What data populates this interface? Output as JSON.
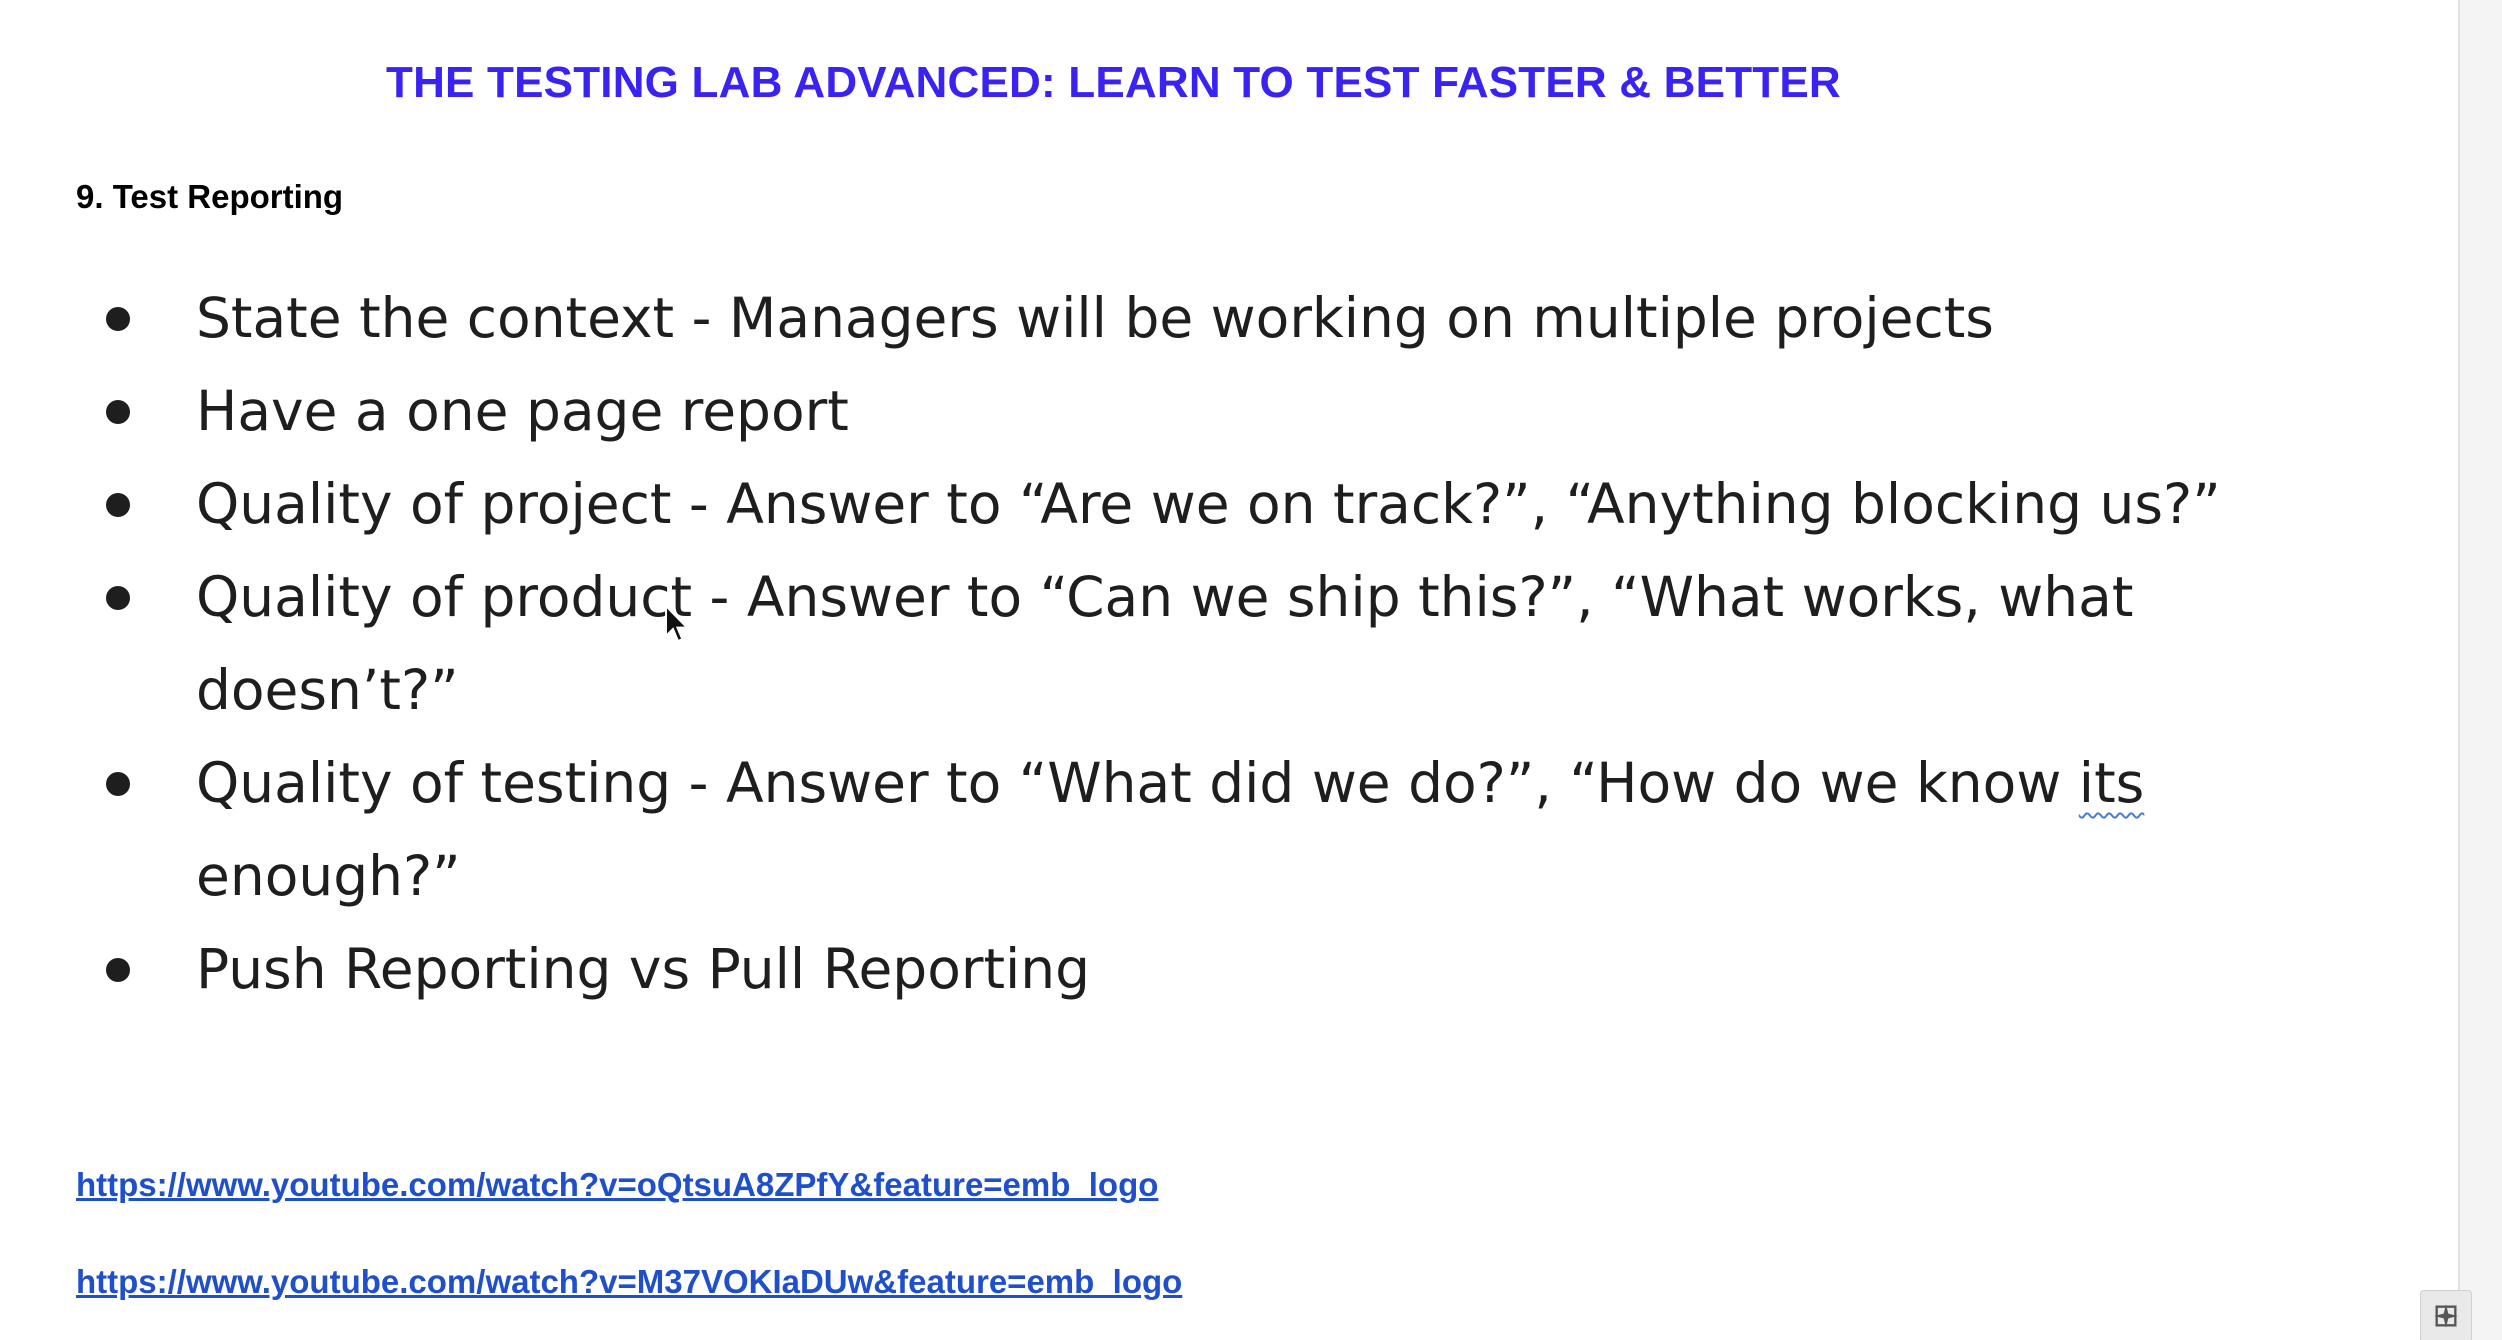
{
  "document": {
    "title": "THE TESTING LAB ADVANCED: LEARN TO TEST FASTER & BETTER",
    "section_heading": "9. Test Reporting",
    "bullets": [
      {
        "text": "State the context - Managers will be working on multiple projects"
      },
      {
        "text": "Have a one page report"
      },
      {
        "text": "Quality of project - Answer to “Are we on track?”, “Anything blocking us?”"
      },
      {
        "text": "Quality of product - Answer to “Can we ship this?”, “What works, what doesn’t?”"
      },
      {
        "text_before": "Quality of testing - Answer to “What did we do?”, “How do we know ",
        "flagged_word": "its",
        "text_after": " enough?”"
      },
      {
        "text": "Push Reporting vs Pull Reporting"
      }
    ],
    "links": [
      {
        "text": "https://www.youtube.com/watch?v=oQtsuA8ZPfY&feature=emb_logo"
      },
      {
        "text": "https://www.youtube.com/watch?v=M37VOKIaDUw&feature=emb_logo"
      }
    ]
  },
  "colors": {
    "title": "#3a22f0",
    "link": "#1f4fc9",
    "body_text": "#1e1e1e",
    "spellcheck_underline": "#4a7bd8"
  },
  "icons": {
    "cursor": "mouse-pointer-icon",
    "corner": "explore-icon"
  }
}
